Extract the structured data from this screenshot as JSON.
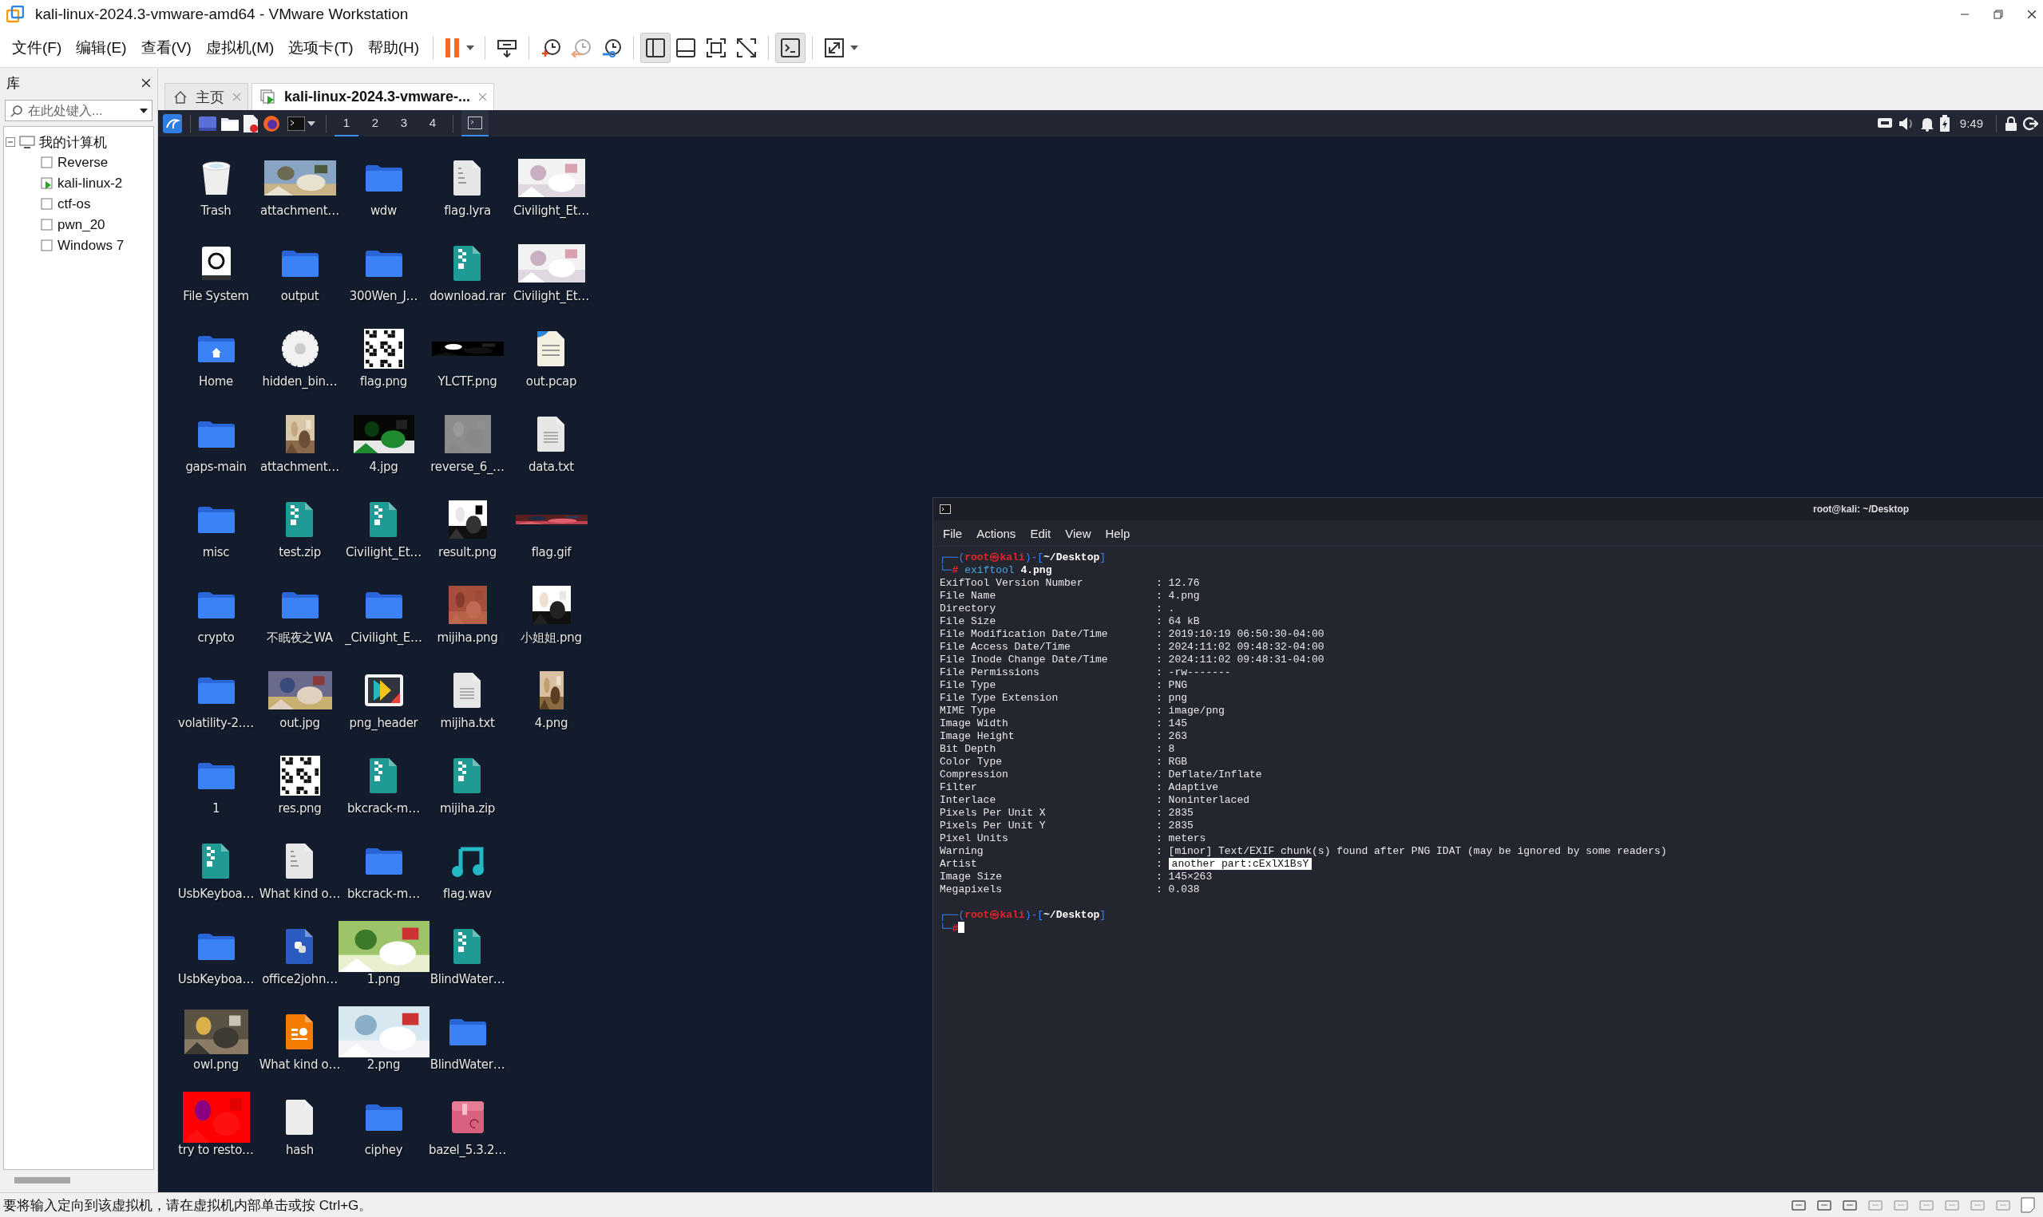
{
  "window": {
    "title": "kali-linux-2024.3-vmware-amd64 - VMware Workstation"
  },
  "menu": [
    "文件(F)",
    "编辑(E)",
    "查看(V)",
    "虚拟机(M)",
    "选项卡(T)",
    "帮助(H)"
  ],
  "toolbar": {
    "view_buttons": [
      {
        "selected": true
      },
      {
        "selected": false
      },
      {
        "selected": false
      },
      {
        "selected": false
      }
    ],
    "console_selected": true
  },
  "library": {
    "title": "库",
    "search": {
      "placeholder": "在此处键入..."
    },
    "tree": [
      {
        "label": "我的计算机",
        "expanded": true,
        "children": [
          {
            "label": "Reverse",
            "running": false
          },
          {
            "label": "kali-linux-2",
            "running": true
          },
          {
            "label": "ctf-os",
            "running": false
          },
          {
            "label": "pwn_20",
            "running": false
          },
          {
            "label": "Windows 7",
            "running": false
          }
        ]
      }
    ]
  },
  "tabs": [
    {
      "label": "主页",
      "kind": "home",
      "selected": false
    },
    {
      "label": "kali-linux-2024.3-vmware-...",
      "kind": "vm",
      "selected": true
    }
  ],
  "kali_panel": {
    "workspaces": [
      {
        "label": "1",
        "selected": true
      },
      {
        "label": "2",
        "selected": false
      },
      {
        "label": "3",
        "selected": false
      },
      {
        "label": "4",
        "selected": false
      }
    ],
    "window_button": {
      "selected": true
    },
    "clock": "9:49"
  },
  "desktop": {
    "icons": [
      {
        "label": "Trash",
        "kind": "trash"
      },
      {
        "label": "File System",
        "kind": "drive"
      },
      {
        "label": "Home",
        "kind": "home"
      },
      {
        "label": "gaps-main",
        "kind": "folder"
      },
      {
        "label": "misc",
        "kind": "folder"
      },
      {
        "label": "crypto",
        "kind": "folder"
      },
      {
        "label": "volatility-2.…",
        "kind": "folder"
      },
      {
        "label": "1",
        "kind": "folder"
      },
      {
        "label": "UsbKeyboa…",
        "kind": "zip"
      },
      {
        "label": "UsbKeyboa…",
        "kind": "folder"
      },
      {
        "label": "owl.png",
        "kind": "picture"
      },
      {
        "label": "try to resto…",
        "kind": "picture"
      },
      {
        "label": "attachment…",
        "kind": "picture"
      },
      {
        "label": "output",
        "kind": "folder"
      },
      {
        "label": "hidden_bin…",
        "kind": "gear"
      },
      {
        "label": "attachment…",
        "kind": "picture"
      },
      {
        "label": "test.zip",
        "kind": "zip"
      },
      {
        "label": "不眠夜之WA",
        "kind": "folder"
      },
      {
        "label": "out.jpg",
        "kind": "picture"
      },
      {
        "label": "res.png",
        "kind": "qr"
      },
      {
        "label": "What kind o…",
        "kind": "binary"
      },
      {
        "label": "office2john…",
        "kind": "python"
      },
      {
        "label": "What kind o…",
        "kind": "slides"
      },
      {
        "label": "hash",
        "kind": "blank"
      },
      {
        "label": "wdw",
        "kind": "folder"
      },
      {
        "label": "300Wen_J…",
        "kind": "folder"
      },
      {
        "label": "flag.png",
        "kind": "qr"
      },
      {
        "label": "4.jpg",
        "kind": "picture"
      },
      {
        "label": "Civilight_Et…",
        "kind": "zip"
      },
      {
        "label": "_Civilight_E…",
        "kind": "folder"
      },
      {
        "label": "png_header",
        "kind": "app"
      },
      {
        "label": "bkcrack-m…",
        "kind": "zip"
      },
      {
        "label": "bkcrack-m…",
        "kind": "folder"
      },
      {
        "label": "1.png",
        "kind": "picture"
      },
      {
        "label": "2.png",
        "kind": "picture"
      },
      {
        "label": "ciphey",
        "kind": "folder"
      },
      {
        "label": "flag.lyra",
        "kind": "binary"
      },
      {
        "label": "download.rar",
        "kind": "zip"
      },
      {
        "label": "YLCTF.png",
        "kind": "picture"
      },
      {
        "label": "reverse_6_…",
        "kind": "picture"
      },
      {
        "label": "result.png",
        "kind": "picture"
      },
      {
        "label": "mijiha.png",
        "kind": "picture"
      },
      {
        "label": "mijiha.txt",
        "kind": "text"
      },
      {
        "label": "mijiha.zip",
        "kind": "zip"
      },
      {
        "label": "flag.wav",
        "kind": "music"
      },
      {
        "label": "BlindWater…",
        "kind": "zip"
      },
      {
        "label": "BlindWater…",
        "kind": "folder"
      },
      {
        "label": "bazel_5.3.2…",
        "kind": "package"
      },
      {
        "label": "Civilight_Et…",
        "kind": "picture"
      },
      {
        "label": "Civilight_Et…",
        "kind": "picture"
      },
      {
        "label": "out.pcap",
        "kind": "pcap"
      },
      {
        "label": "data.txt",
        "kind": "text"
      },
      {
        "label": "flag.gif",
        "kind": "picture"
      },
      {
        "label": "小姐姐.png",
        "kind": "picture"
      },
      {
        "label": "4.png",
        "kind": "picture"
      }
    ]
  },
  "terminal": {
    "title": "root@kali: ~/Desktop",
    "menu": [
      "File",
      "Actions",
      "Edit",
      "View",
      "Help"
    ],
    "blocks": [
      {
        "prompt": {
          "open": "┌──(",
          "user": "root",
          "at": "㉿",
          "host": "kali",
          "mid": ")-[",
          "path": "~/Desktop",
          "close": "]",
          "corner": "└─",
          "symbol": "#"
        },
        "command": "exiftool",
        "argument": "4.png",
        "output": [
          {
            "key": "ExifTool Version Number",
            "sep": ":",
            "value": "12.76",
            "highlighted": false
          },
          {
            "key": "File Name",
            "sep": ":",
            "value": "4.png",
            "highlighted": false
          },
          {
            "key": "Directory",
            "sep": ":",
            "value": ".",
            "highlighted": false
          },
          {
            "key": "File Size",
            "sep": ":",
            "value": "64 kB",
            "highlighted": false
          },
          {
            "key": "File Modification Date/Time",
            "sep": ":",
            "value": "2019:10:19 06:50:30-04:00",
            "highlighted": false
          },
          {
            "key": "File Access Date/Time",
            "sep": ":",
            "value": "2024:11:02 09:48:32-04:00",
            "highlighted": false
          },
          {
            "key": "File Inode Change Date/Time",
            "sep": ":",
            "value": "2024:11:02 09:48:31-04:00",
            "highlighted": false
          },
          {
            "key": "File Permissions",
            "sep": ":",
            "value": "-rw-------",
            "highlighted": false
          },
          {
            "key": "File Type",
            "sep": ":",
            "value": "PNG",
            "highlighted": false
          },
          {
            "key": "File Type Extension",
            "sep": ":",
            "value": "png",
            "highlighted": false
          },
          {
            "key": "MIME Type",
            "sep": ":",
            "value": "image/png",
            "highlighted": false
          },
          {
            "key": "Image Width",
            "sep": ":",
            "value": "145",
            "highlighted": false
          },
          {
            "key": "Image Height",
            "sep": ":",
            "value": "263",
            "highlighted": false
          },
          {
            "key": "Bit Depth",
            "sep": ":",
            "value": "8",
            "highlighted": false
          },
          {
            "key": "Color Type",
            "sep": ":",
            "value": "RGB",
            "highlighted": false
          },
          {
            "key": "Compression",
            "sep": ":",
            "value": "Deflate/Inflate",
            "highlighted": false
          },
          {
            "key": "Filter",
            "sep": ":",
            "value": "Adaptive",
            "highlighted": false
          },
          {
            "key": "Interlace",
            "sep": ":",
            "value": "Noninterlaced",
            "highlighted": false
          },
          {
            "key": "Pixels Per Unit X",
            "sep": ":",
            "value": "2835",
            "highlighted": false
          },
          {
            "key": "Pixels Per Unit Y",
            "sep": ":",
            "value": "2835",
            "highlighted": false
          },
          {
            "key": "Pixel Units",
            "sep": ":",
            "value": "meters",
            "highlighted": false
          },
          {
            "key": "Warning",
            "sep": ":",
            "value": "[minor] Text/EXIF chunk(s) found after PNG IDAT (may be ignored by some readers)",
            "highlighted": false
          },
          {
            "key": "Artist",
            "sep": ":",
            "value": "another part:cExlX1BsY",
            "highlighted": true
          },
          {
            "key": "Image Size",
            "sep": ":",
            "value": "145×263",
            "highlighted": false
          },
          {
            "key": "Megapixels",
            "sep": ":",
            "value": "0.038",
            "highlighted": false
          }
        ]
      },
      {
        "prompt": {
          "open": "┌──(",
          "user": "root",
          "at": "㉿",
          "host": "kali",
          "mid": ")-[",
          "path": "~/Desktop",
          "close": "]",
          "corner": "└─",
          "symbol": "#"
        },
        "cursor": true
      }
    ]
  },
  "status_bar": {
    "message": "要将输入定向到该虚拟机，请在虚拟机内部单击或按 Ctrl+G。"
  }
}
